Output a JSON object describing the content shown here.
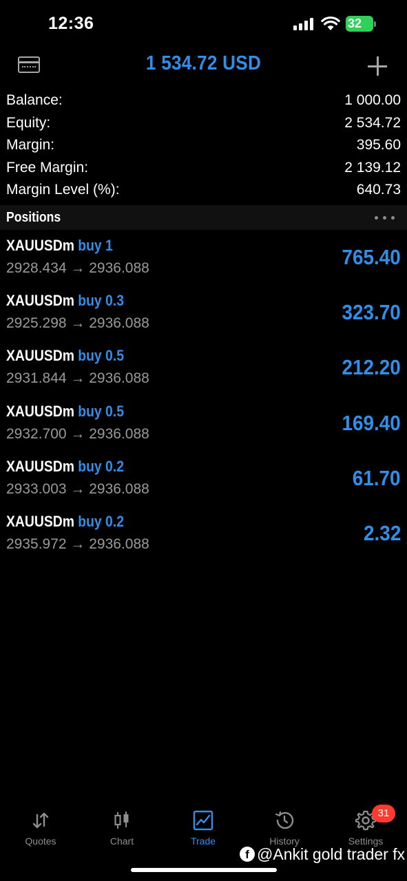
{
  "status_bar": {
    "time": "12:36",
    "battery": "32"
  },
  "header": {
    "title": "1 534.72 USD",
    "left_icon": "account-card-icon",
    "right_icon": "plus-icon"
  },
  "summary": [
    {
      "label": "Balance:",
      "value": "1 000.00"
    },
    {
      "label": "Equity:",
      "value": "2 534.72"
    },
    {
      "label": "Margin:",
      "value": "395.60"
    },
    {
      "label": "Free Margin:",
      "value": "2 139.12"
    },
    {
      "label": "Margin Level (%):",
      "value": "640.73"
    }
  ],
  "positions": {
    "title": "Positions",
    "items": [
      {
        "symbol": "XAUUSDm",
        "side": "buy 1",
        "prices": "2928.434 → 2936.088",
        "profit": "765.40"
      },
      {
        "symbol": "XAUUSDm",
        "side": "buy 0.3",
        "prices": "2925.298 → 2936.088",
        "profit": "323.70"
      },
      {
        "symbol": "XAUUSDm",
        "side": "buy 0.5",
        "prices": "2931.844 → 2936.088",
        "profit": "212.20"
      },
      {
        "symbol": "XAUUSDm",
        "side": "buy 0.5",
        "prices": "2932.700 → 2936.088",
        "profit": "169.40"
      },
      {
        "symbol": "XAUUSDm",
        "side": "buy 0.2",
        "prices": "2933.003 → 2936.088",
        "profit": "61.70"
      },
      {
        "symbol": "XAUUSDm",
        "side": "buy 0.2",
        "prices": "2935.972 → 2936.088",
        "profit": "2.32"
      }
    ]
  },
  "tabs": [
    {
      "label": "Quotes",
      "icon": "quotes-arrows-icon"
    },
    {
      "label": "Chart",
      "icon": "candlestick-icon"
    },
    {
      "label": "Trade",
      "icon": "trade-chart-icon",
      "active": true
    },
    {
      "label": "History",
      "icon": "history-clock-icon"
    },
    {
      "label": "Settings",
      "icon": "gear-icon"
    }
  ],
  "settings_badge": "31",
  "watermark": "@Ankit gold trader fx",
  "colors": {
    "accent": "#2f8fea",
    "background": "#000000",
    "secondary_text": "#9a9a9a",
    "badge": "#ff3b30"
  }
}
